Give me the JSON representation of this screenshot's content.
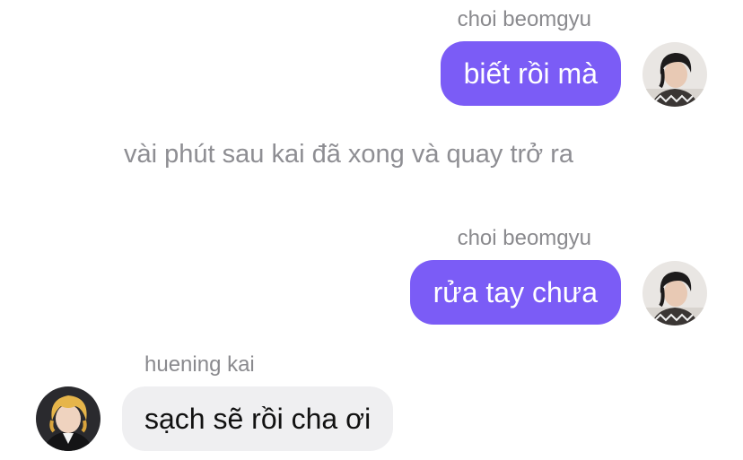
{
  "messages": [
    {
      "sender": "choi beomgyu",
      "text": "biết rồi mà",
      "direction": "outgoing",
      "avatar_icon": "profile-photo-icon"
    },
    {
      "sender": "choi beomgyu",
      "text": "rửa tay chưa",
      "direction": "outgoing",
      "avatar_icon": "profile-photo-icon"
    },
    {
      "sender": "huening kai",
      "text": "sạch sẽ rồi cha ơi",
      "direction": "incoming",
      "avatar_icon": "profile-photo-icon"
    }
  ],
  "narration": "vài phút sau kai đã xong và quay trở ra",
  "colors": {
    "sent_bubble": "#7b5cf6",
    "received_bubble": "#efeff1",
    "sender_name": "#8a8a8e",
    "narration_text": "#8e8e93"
  }
}
